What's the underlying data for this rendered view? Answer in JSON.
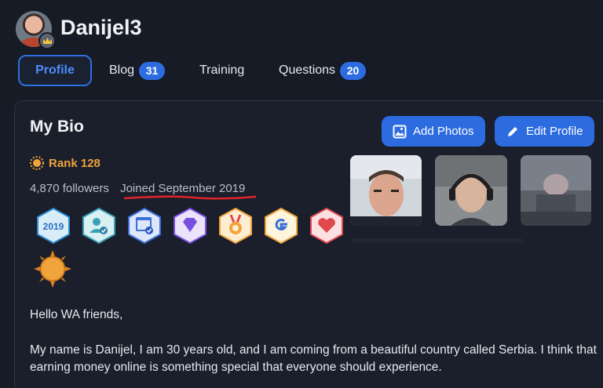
{
  "profile": {
    "username": "Danijel3",
    "avatar_icon": "user-avatar",
    "crown_icon": "crown-icon"
  },
  "tabs": [
    {
      "label": "Profile",
      "active": true,
      "count": null
    },
    {
      "label": "Blog",
      "active": false,
      "count": "31"
    },
    {
      "label": "Training",
      "active": false,
      "count": null
    },
    {
      "label": "Questions",
      "active": false,
      "count": "20"
    }
  ],
  "bio": {
    "title": "My Bio",
    "add_photos_label": "Add Photos",
    "edit_profile_label": "Edit Profile",
    "rank": "Rank 128",
    "followers": "4,870 followers",
    "joined": "Joined September 2019",
    "badges": [
      {
        "icon": "year-2019-badge",
        "text": "2019",
        "color": "#2a8bd6"
      },
      {
        "icon": "verified-user-badge",
        "color": "#3aa1b5"
      },
      {
        "icon": "verified-website-badge",
        "color": "#3b6fd9"
      },
      {
        "icon": "diamond-badge",
        "color": "#7a4fe0"
      },
      {
        "icon": "medal-badge",
        "color": "#f0a43b"
      },
      {
        "icon": "google-badge",
        "color": "#f2a33a"
      },
      {
        "icon": "heart-badge",
        "color": "#e0484e"
      },
      {
        "icon": "sun-rank-badge",
        "color": "#f0a43b"
      }
    ],
    "greeting": "Hello WA friends,",
    "paragraph_line1": "My name is Danijel, I am 30 years old, and I am coming from a beautiful country called Serbia. I think that",
    "paragraph_line2": "earning money online is something special that everyone should experience."
  },
  "photos": [
    {
      "icon": "profile-photo-selfie"
    },
    {
      "icon": "profile-photo-headphones"
    },
    {
      "icon": "profile-photo-dark-room"
    }
  ],
  "colors": {
    "accent": "#2c6ce0",
    "rank": "#f0a43b",
    "background": "#161b26",
    "annotation_underline": "#e0242a"
  }
}
